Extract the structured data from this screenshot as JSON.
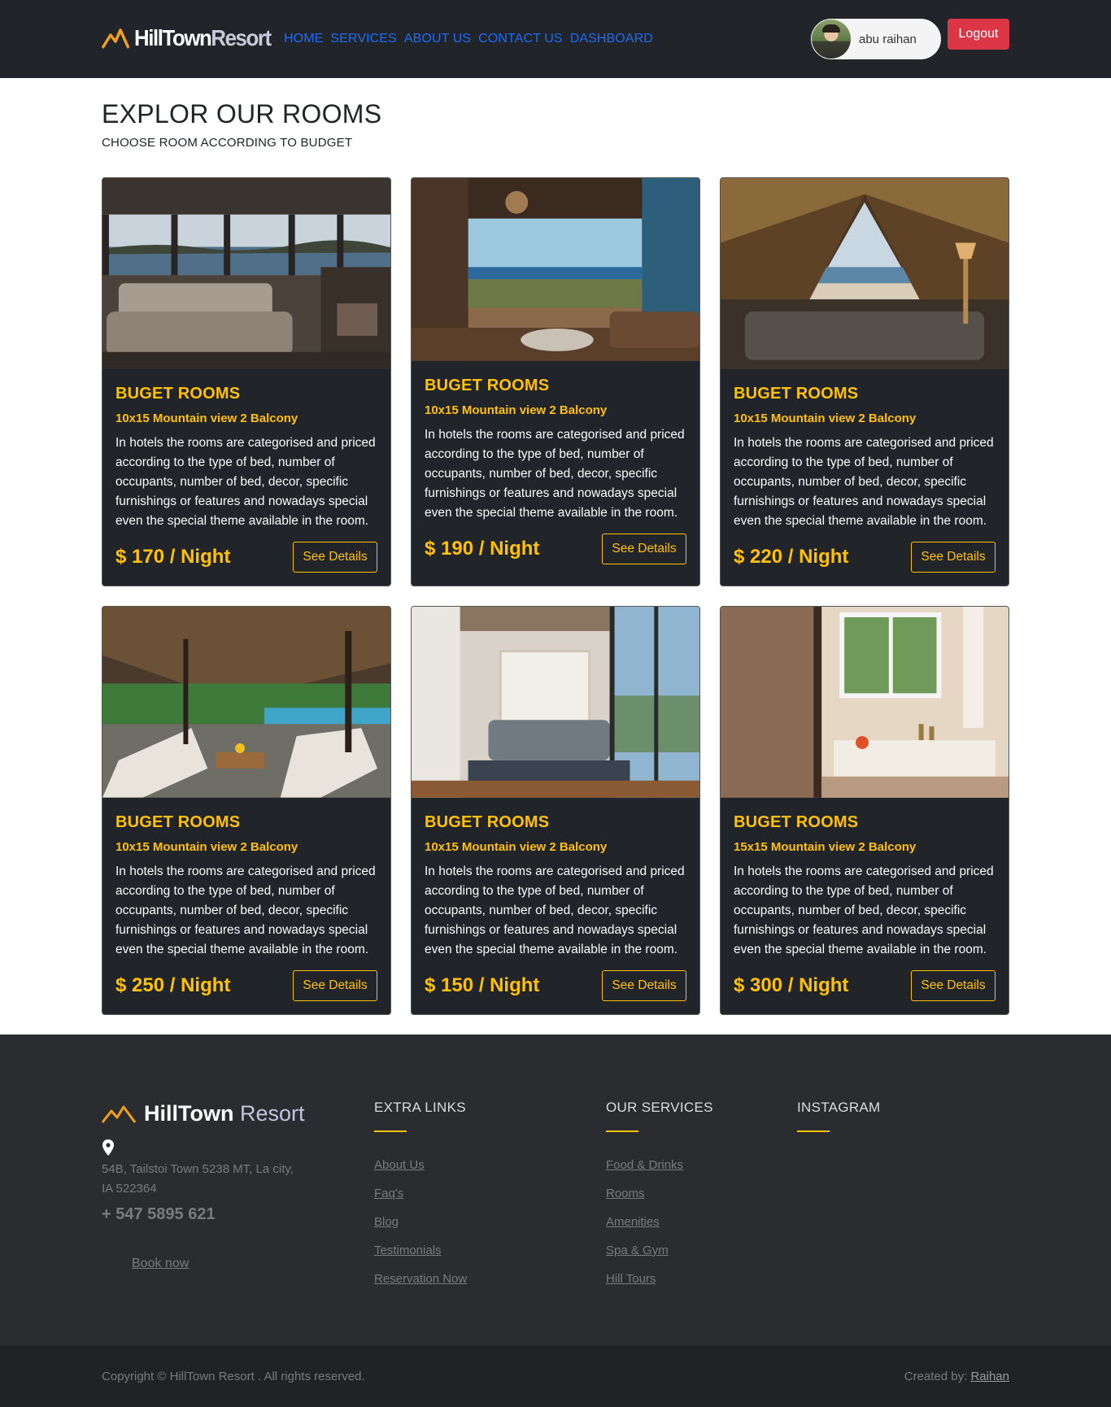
{
  "nav": {
    "brand_part1": "HillTown",
    "brand_part2": "Resort",
    "links": [
      "HOME",
      "SERVICES",
      "ABOUT US",
      "CONTACT US",
      "DASHBOARD"
    ],
    "user_name": "abu raihan",
    "logout_label": "Logout",
    "link_color": "#1e6bf5",
    "logout_color": "#dc3545"
  },
  "heading": {
    "title": "EXPLOR OUR ROOMS",
    "subtitle": "CHOOSE ROOM ACCORDING TO BUDGET"
  },
  "rooms": [
    {
      "title": "BUGET ROOMS",
      "subtitle": "10x15 Mountain view 2 Balcony",
      "description": "In hotels the rooms are categorised and priced according to the type of bed, number of occupants, number of bed, decor, specific furnishings or features and nowadays special even the special theme available in the room.",
      "price": "$ 170 / Night",
      "button": "See Details"
    },
    {
      "title": "BUGET ROOMS",
      "subtitle": "10x15 Mountain view 2 Balcony",
      "description": "In hotels the rooms are categorised and priced according to the type of bed, number of occupants, number of bed, decor, specific furnishings or features and nowadays special even the special theme available in the room.",
      "price": "$ 190 / Night",
      "button": "See Details"
    },
    {
      "title": "BUGET ROOMS",
      "subtitle": "10x15 Mountain view 2 Balcony",
      "description": "In hotels the rooms are categorised and priced according to the type of bed, number of occupants, number of bed, decor, specific furnishings or features and nowadays special even the special theme available in the room.",
      "price": "$ 220 / Night",
      "button": "See Details"
    },
    {
      "title": "BUGET ROOMS",
      "subtitle": "10x15 Mountain view 2 Balcony",
      "description": "In hotels the rooms are categorised and priced according to the type of bed, number of occupants, number of bed, decor, specific furnishings or features and nowadays special even the special theme available in the room.",
      "price": "$ 250 / Night",
      "button": "See Details"
    },
    {
      "title": "BUGET ROOMS",
      "subtitle": "10x15 Mountain view 2 Balcony",
      "description": "In hotels the rooms are categorised and priced according to the type of bed, number of occupants, number of bed, decor, specific furnishings or features and nowadays special even the special theme available in the room.",
      "price": "$ 150 / Night",
      "button": "See Details"
    },
    {
      "title": "BUGET ROOMS",
      "subtitle": "15x15 Mountain view 2 Balcony",
      "description": "In hotels the rooms are categorised and priced according to the type of bed, number of occupants, number of bed, decor, specific furnishings or features and nowadays special even the special theme available in the room.",
      "price": "$ 300 / Night",
      "button": "See Details"
    }
  ],
  "footer": {
    "brand_part1": "HillTown",
    "brand_part2": "Resort",
    "address": "54B, Tailstoi Town 5238 MT, La city, IA 522364",
    "phone": "+ 547 5895 621",
    "book_now": "Book now",
    "extra_links": {
      "heading": "EXTRA LINKS",
      "items": [
        "About Us",
        "Faq's",
        "Blog",
        "Testimonials",
        "Reservation Now"
      ]
    },
    "our_services": {
      "heading": "OUR SERVICES",
      "items": [
        "Food & Drinks",
        "Rooms",
        "Amenities",
        "Spa & Gym",
        "Hill Tours"
      ]
    },
    "instagram": {
      "heading": "INSTAGRAM"
    },
    "accent_color": "#ffc107",
    "copyright": "Copyright © HillTown Resort . All rights reserved.",
    "created_by_label": "Created by:",
    "created_by_name": "Raihan"
  }
}
